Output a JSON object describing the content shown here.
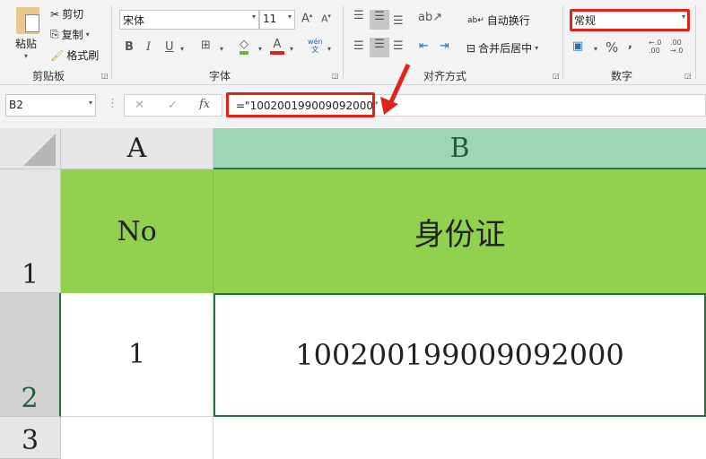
{
  "clipboard": {
    "paste": "粘贴",
    "cut": "剪切",
    "copy": "复制",
    "format_painter": "格式刷",
    "group": "剪贴板"
  },
  "font": {
    "name": "宋体",
    "size": "11",
    "bold": "B",
    "italic": "I",
    "underline": "U",
    "phonetic": "wén\n文",
    "group": "字体"
  },
  "alignment": {
    "wrap_text": "自动换行",
    "merge_center": "合并后居中",
    "group": "对齐方式"
  },
  "number": {
    "format": "常规",
    "percent": "%",
    "comma": ",",
    "inc_decimal": "←.0 .00",
    "dec_decimal": ".00 →.0",
    "group": "数字"
  },
  "formula_bar": {
    "name_box": "B2",
    "cancel": "✕",
    "enter": "✓",
    "fx": "fx",
    "formula": "=\"100200199009092000\""
  },
  "sheet": {
    "columns": [
      "A",
      "B"
    ],
    "rows": [
      "1",
      "2",
      "3"
    ],
    "cells": {
      "A1": "No",
      "B1": "身份证",
      "A2": "1",
      "B2": "100200199009092000"
    }
  },
  "colors": {
    "header_fill": "#92d050",
    "highlight": "#e0231b",
    "selected_col": "#9fd5b7"
  }
}
